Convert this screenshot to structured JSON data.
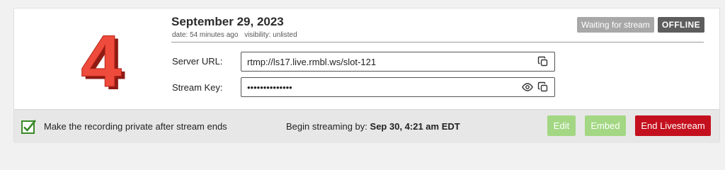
{
  "stream": {
    "title": "September 29, 2023",
    "date_text": "date: 54 minutes ago",
    "visibility_text": "visibility: unlisted",
    "thumbnail_digit": "4",
    "thumbnail_color": "#e53935"
  },
  "status": {
    "waiting_label": "Waiting for stream",
    "offline_label": "OFFLINE"
  },
  "server_url": {
    "label": "Server URL:",
    "value": "rtmp://ls17.live.rmbl.ws/slot-121",
    "copy_icon": "copy-icon"
  },
  "stream_key": {
    "label": "Stream Key:",
    "value": "••••••••••••••",
    "reveal_icon": "eye-icon",
    "copy_icon": "copy-icon"
  },
  "footer": {
    "private_checkbox_label": "Make the recording private after stream ends",
    "private_checked": true,
    "begin_prefix": "Begin streaming by:",
    "begin_time": "Sep 30, 4:21 am EDT",
    "edit_label": "Edit",
    "embed_label": "Embed",
    "end_label": "End Livestream"
  },
  "colors": {
    "accent_green": "#a3d783",
    "danger_red": "#c4101e",
    "checkbox_green": "#3a8a2a"
  }
}
